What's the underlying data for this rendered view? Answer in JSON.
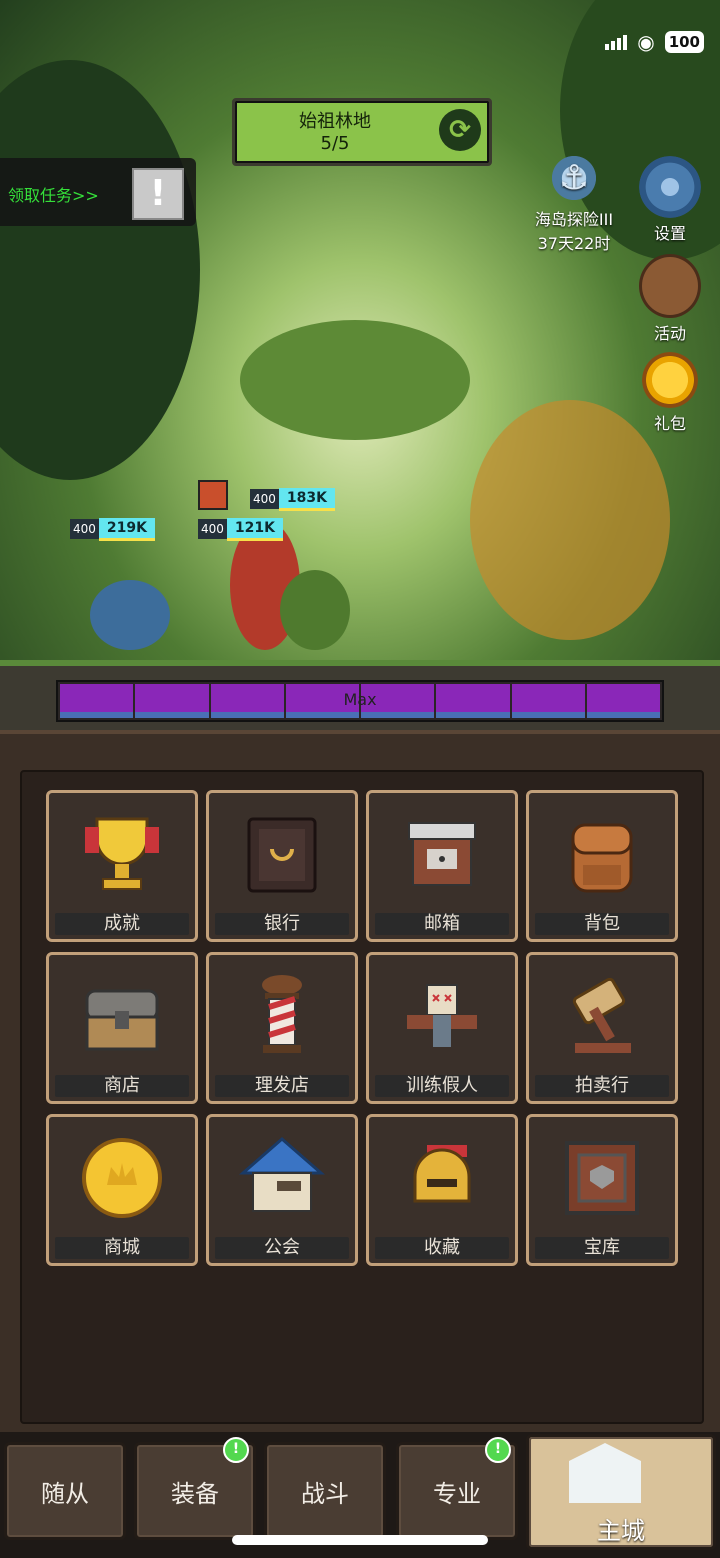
{
  "status": {
    "battery": "100"
  },
  "stage": {
    "name": "始祖林地",
    "count": "5/5",
    "refresh_icon": "refresh-icon"
  },
  "quest": {
    "label": "领取任务>>",
    "button_icon": "exclamation-icon"
  },
  "side_icons": {
    "island": {
      "title": "海岛探险III",
      "timer": "37天22时"
    },
    "settings": "设置",
    "events": "活动",
    "gifts": "礼包"
  },
  "combat": {
    "left": {
      "level": "400",
      "hp": "219K"
    },
    "middle": {
      "level": "400",
      "hp": "121K"
    },
    "right": {
      "level": "400",
      "hp": "183K"
    }
  },
  "energy": {
    "label": "Max",
    "segments": 8
  },
  "menu": [
    {
      "label": "成就",
      "icon": "trophy-icon"
    },
    {
      "label": "银行",
      "icon": "safe-icon"
    },
    {
      "label": "邮箱",
      "icon": "mailbox-icon"
    },
    {
      "label": "背包",
      "icon": "backpack-icon"
    },
    {
      "label": "商店",
      "icon": "chest-icon"
    },
    {
      "label": "理发店",
      "icon": "barber-pole-icon"
    },
    {
      "label": "训练假人",
      "icon": "training-dummy-icon"
    },
    {
      "label": "拍卖行",
      "icon": "gavel-icon"
    },
    {
      "label": "商城",
      "icon": "crown-coin-icon"
    },
    {
      "label": "公会",
      "icon": "guild-house-icon"
    },
    {
      "label": "收藏",
      "icon": "helmet-icon"
    },
    {
      "label": "宝库",
      "icon": "vault-icon"
    }
  ],
  "nav": {
    "followers": "随从",
    "equipment": "装备",
    "battle": "战斗",
    "profession": "专业",
    "main_city": "主城",
    "badge": "!"
  },
  "colors": {
    "stage_green": "#8bc34a",
    "energy_purple": "#8a27b8",
    "hp_cyan": "#63e6f0",
    "quest_green": "#35e03a"
  }
}
